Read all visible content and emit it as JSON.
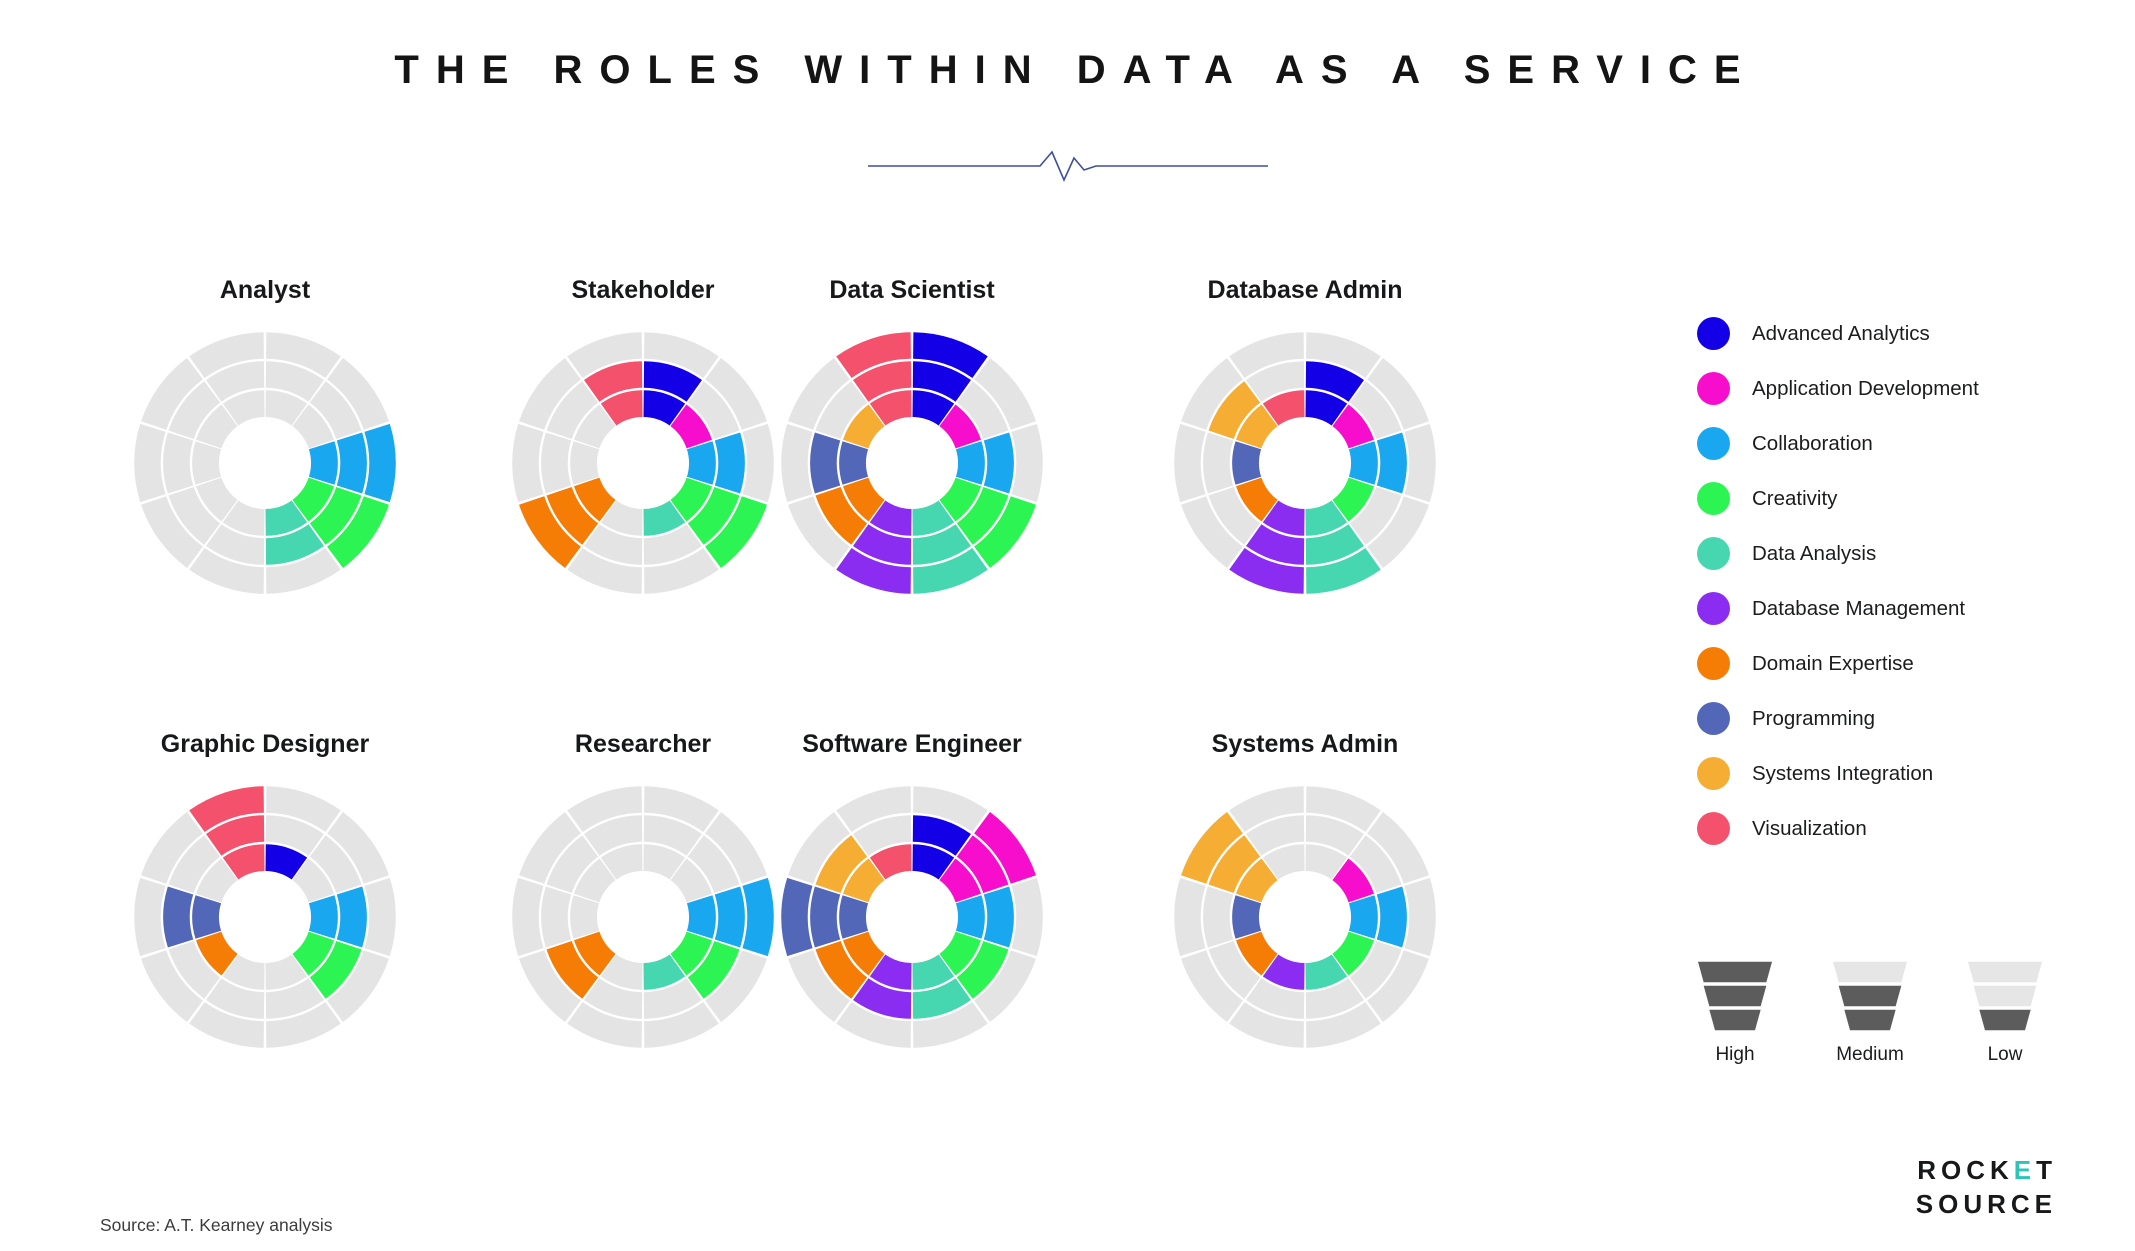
{
  "title": "THE ROLES WITHIN DATA AS A SERVICE",
  "source": "Source: A.T. Kearney analysis",
  "logo": {
    "line1_a": "ROCK",
    "line1_e": "E",
    "line1_b": "T",
    "line2": "SOURCE"
  },
  "legend": {
    "items": [
      {
        "label": "Advanced Analytics",
        "color": "#1400e6"
      },
      {
        "label": "Application Development",
        "color": "#f70ecc"
      },
      {
        "label": "Collaboration",
        "color": "#19a7f0"
      },
      {
        "label": "Creativity",
        "color": "#2cf553"
      },
      {
        "label": "Data Analysis",
        "color": "#46d6b0"
      },
      {
        "label": "Database Management",
        "color": "#8b2df0"
      },
      {
        "label": "Domain Expertise",
        "color": "#f57c05"
      },
      {
        "label": "Programming",
        "color": "#5267b8"
      },
      {
        "label": "Systems Integration",
        "color": "#f5ad33"
      },
      {
        "label": "Visualization",
        "color": "#f4526c"
      }
    ]
  },
  "intensity_key": {
    "items": [
      {
        "label": "High",
        "level": 3
      },
      {
        "label": "Medium",
        "level": 2
      },
      {
        "label": "Low",
        "level": 1
      }
    ],
    "fill_color": "#5c5c5c",
    "empty_color": "#e6e6e6"
  },
  "chart_data": {
    "type": "pie",
    "subtype": "multi-ring radial heatmap (sunburst) small-multiples",
    "title": "THE ROLES WITHIN DATA AS A SERVICE",
    "rings": 3,
    "ring_scale": [
      "Low",
      "Medium",
      "High"
    ],
    "sector_count": 10,
    "sector_degrees": 36,
    "start_angle_deg": 0,
    "empty_color": "#e4e4e4",
    "gap_color": "#ffffff",
    "categories": [
      "Advanced Analytics",
      "Application Development",
      "Collaboration",
      "Creativity",
      "Data Analysis",
      "Database Management",
      "Domain Expertise",
      "Programming",
      "Systems Integration",
      "Visualization"
    ],
    "value_legend": {
      "0": "none",
      "1": "Low",
      "2": "Medium",
      "3": "High"
    },
    "series": [
      {
        "name": "Analyst",
        "values": [
          0,
          0,
          3,
          3,
          2,
          0,
          0,
          0,
          0,
          0
        ]
      },
      {
        "name": "Stakeholder",
        "values": [
          2,
          1,
          2,
          3,
          1,
          0,
          3,
          0,
          0,
          2
        ]
      },
      {
        "name": "Data Scientist",
        "values": [
          3,
          1,
          2,
          3,
          3,
          3,
          2,
          2,
          1,
          3
        ]
      },
      {
        "name": "Database Admin",
        "values": [
          2,
          1,
          2,
          1,
          3,
          3,
          1,
          1,
          2,
          1
        ]
      },
      {
        "name": "Graphic Designer",
        "values": [
          1,
          0,
          2,
          2,
          0,
          0,
          1,
          2,
          0,
          3
        ]
      },
      {
        "name": "Researcher",
        "values": [
          0,
          0,
          3,
          2,
          1,
          0,
          2,
          0,
          0,
          0
        ]
      },
      {
        "name": "Software Engineer",
        "values": [
          2,
          3,
          2,
          2,
          2,
          2,
          2,
          3,
          2,
          1
        ]
      },
      {
        "name": "Systems Admin",
        "values": [
          0,
          1,
          2,
          1,
          1,
          1,
          1,
          1,
          3,
          0
        ]
      }
    ]
  }
}
